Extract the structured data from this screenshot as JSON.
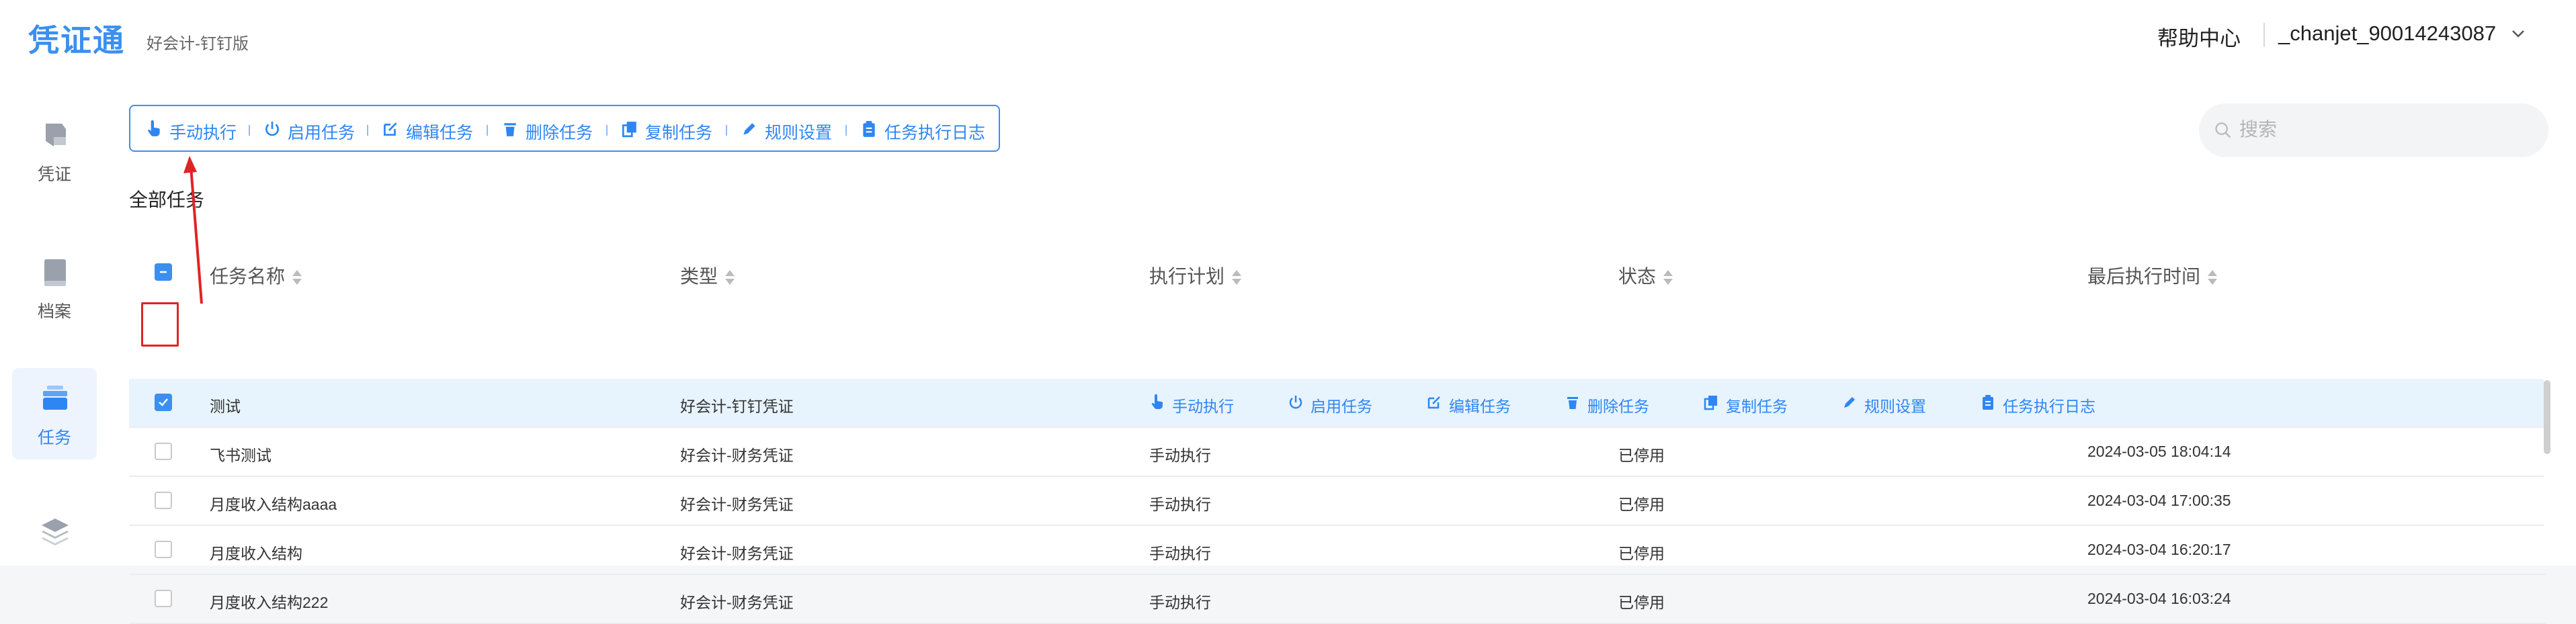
{
  "header": {
    "logo": "凭证通",
    "edition": "好会计-钉钉版",
    "help": "帮助中心",
    "user": "_chanjet_90014243087"
  },
  "sidebar": {
    "items": [
      {
        "label": "凭证",
        "icon": "voucher-icon",
        "active": false
      },
      {
        "label": "档案",
        "icon": "book-icon",
        "active": false
      },
      {
        "label": "任务",
        "icon": "task-icon",
        "active": true
      },
      {
        "label": "",
        "icon": "layers-icon",
        "active": false
      }
    ]
  },
  "toolbar": {
    "buttons": [
      {
        "label": "手动执行",
        "icon": "hand-pointer-icon"
      },
      {
        "label": "启用任务",
        "icon": "power-icon"
      },
      {
        "label": "编辑任务",
        "icon": "edit-icon"
      },
      {
        "label": "删除任务",
        "icon": "trash-icon"
      },
      {
        "label": "复制任务",
        "icon": "copy-icon"
      },
      {
        "label": "规则设置",
        "icon": "pencil-icon"
      },
      {
        "label": "任务执行日志",
        "icon": "clipboard-icon"
      }
    ]
  },
  "search": {
    "placeholder": "搜索"
  },
  "section": {
    "title": "全部任务"
  },
  "table": {
    "columns": [
      "任务名称",
      "类型",
      "执行计划",
      "状态",
      "最后执行时间"
    ],
    "rows": [
      {
        "name": "测试",
        "type": "好会计-钉钉凭证",
        "plan": "",
        "status": "",
        "last_run": "",
        "selected": true
      },
      {
        "name": "飞书测试",
        "type": "好会计-财务凭证",
        "plan": "手动执行",
        "status": "已停用",
        "last_run": "2024-03-05 18:04:14",
        "selected": false
      },
      {
        "name": "月度收入结构aaaa",
        "type": "好会计-财务凭证",
        "plan": "手动执行",
        "status": "已停用",
        "last_run": "2024-03-04 17:00:35",
        "selected": false
      },
      {
        "name": "月度收入结构",
        "type": "好会计-财务凭证",
        "plan": "手动执行",
        "status": "已停用",
        "last_run": "2024-03-04 16:20:17",
        "selected": false
      },
      {
        "name": "月度收入结构222",
        "type": "好会计-财务凭证",
        "plan": "手动执行",
        "status": "已停用",
        "last_run": "2024-03-04 16:03:24",
        "selected": false
      }
    ],
    "row_actions": [
      "手动执行",
      "启用任务",
      "编辑任务",
      "删除任务",
      "复制任务",
      "规则设置",
      "任务执行日志"
    ]
  },
  "colors": {
    "accent": "#3b8ff0",
    "selected_row": "#e7f3fd",
    "annotation": "#e02424"
  }
}
